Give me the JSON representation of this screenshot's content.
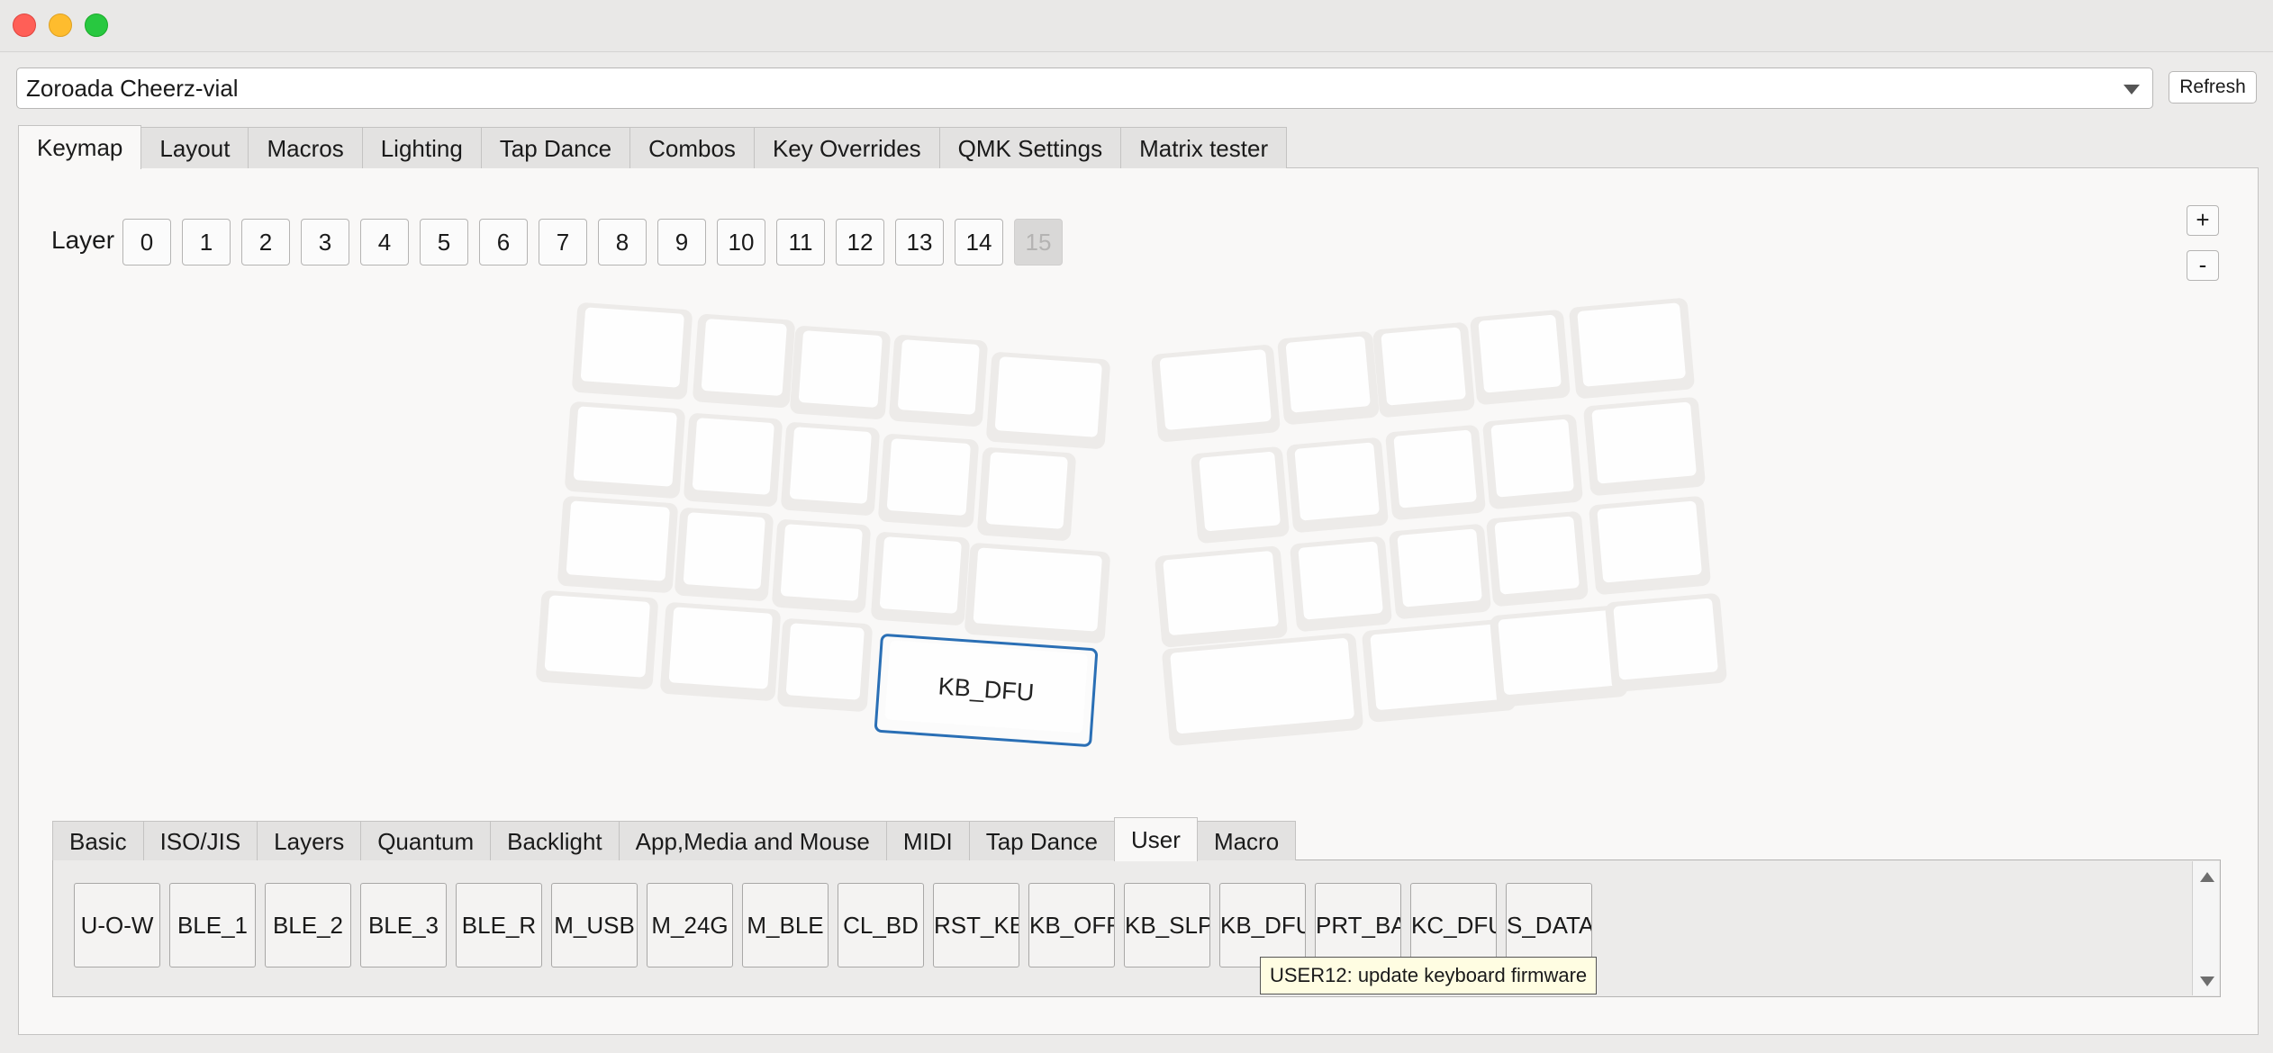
{
  "window": {
    "controls": [
      "close",
      "minimize",
      "zoom"
    ]
  },
  "keyboard_selector": {
    "value": "Zoroada Cheerz-vial",
    "refresh_label": "Refresh"
  },
  "main_tabs": [
    {
      "label": "Keymap",
      "active": true
    },
    {
      "label": "Layout"
    },
    {
      "label": "Macros"
    },
    {
      "label": "Lighting"
    },
    {
      "label": "Tap Dance"
    },
    {
      "label": "Combos"
    },
    {
      "label": "Key Overrides"
    },
    {
      "label": "QMK Settings"
    },
    {
      "label": "Matrix tester"
    }
  ],
  "layers": {
    "label": "Layer",
    "buttons": [
      "0",
      "1",
      "2",
      "3",
      "4",
      "5",
      "6",
      "7",
      "8",
      "9",
      "10",
      "11",
      "12",
      "13",
      "14",
      "15"
    ],
    "disabled": "15"
  },
  "zoom": {
    "plus": "+",
    "minus": "-"
  },
  "keymap": {
    "selected_key_label": "KB_DFU"
  },
  "keycode_tabs": [
    {
      "label": "Basic"
    },
    {
      "label": "ISO/JIS"
    },
    {
      "label": "Layers"
    },
    {
      "label": "Quantum"
    },
    {
      "label": "Backlight"
    },
    {
      "label": "App,Media and Mouse"
    },
    {
      "label": "MIDI"
    },
    {
      "label": "Tap Dance"
    },
    {
      "label": "User",
      "active": true
    },
    {
      "label": "Macro"
    }
  ],
  "keycodes": [
    "U-O-W",
    "BLE_1",
    "BLE_2",
    "BLE_3",
    "BLE_R",
    "M_USB",
    "M_24G",
    "M_BLE",
    "CL_BD",
    "RST_KB",
    "KB_OFF",
    "KB_SLP",
    "KB_DFU",
    "PRT_BAT",
    "KC_DFU",
    "S_DATA"
  ],
  "tooltip": "USER12: update keyboard firmware",
  "colors": {
    "selection_border": "#2a6fb5",
    "tooltip_bg": "#fffde2"
  }
}
